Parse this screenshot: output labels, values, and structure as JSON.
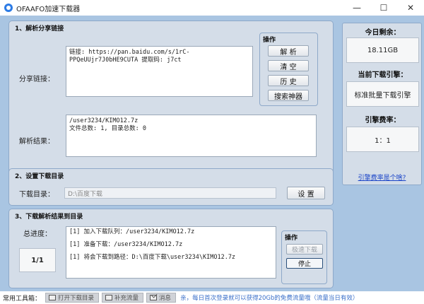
{
  "window": {
    "title": "OFAAFO加速下载器",
    "minimize": "—",
    "maximize": "☐",
    "close": "✕"
  },
  "section1": {
    "title": "1、解析分享链接",
    "share_label": "分享链接：",
    "share_text": "链接: https://pan.baidu.com/s/1rC-PPQeUUjr7J0bHE9CUTA 提取码: j7ct",
    "result_label": "解析结果：",
    "result_text": "/user3234/KIMO12.7z\n文件总数: 1, 目录总数: 0",
    "ops": {
      "title": "操作",
      "parse": "解  析",
      "clear": "清  空",
      "history": "历  史",
      "search": "搜索神器"
    }
  },
  "section2": {
    "title": "2、设置下载目录",
    "dir_label": "下载目录：",
    "dir_value": "D:\\百度下载",
    "set_button": "设  置"
  },
  "section3": {
    "title": "3、下载解析结果到目录",
    "progress_label": "总进度：",
    "progress_value": "1/1",
    "log_text": "[1] 加入下载队列：/user3234/KIMO12.7z\n\n[1] 准备下载：/user3234/KIMO12.7z\n\n[1] 将会下载到路径：D:\\百度下载\\user3234\\KIMO12.7z",
    "ops": {
      "title": "操作",
      "fast": "极速下载",
      "stop": "停止"
    }
  },
  "right": {
    "today_title": "今日剩余：",
    "today_value": "18.11GB",
    "engine_title": "当前下载引擎：",
    "engine_value": "标准批量下载引擎",
    "rate_title": "引擎费率：",
    "rate_value": "1：1",
    "link": "引擎费率是个啥?"
  },
  "statusbar": {
    "label": "常用工具箱：",
    "open_dir": "打开下载目录",
    "supplement": "补充流量",
    "message": "消息",
    "tip": "亲，每日首次登录就可以获得20Gb的免费流量哦（流量当日有效）"
  }
}
